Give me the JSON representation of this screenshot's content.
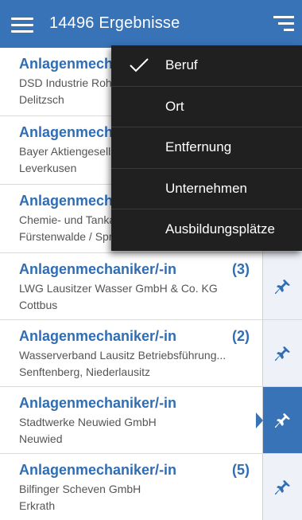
{
  "header": {
    "title": "14496 Ergebnisse",
    "menu_icon": "hamburger-menu-icon",
    "sort_icon": "sort-filter-icon",
    "color": "#3872b7"
  },
  "sort_menu": {
    "items": [
      {
        "label": "Beruf",
        "checked": true
      },
      {
        "label": "Ort",
        "checked": false
      },
      {
        "label": "Entfernung",
        "checked": false
      },
      {
        "label": "Unternehmen",
        "checked": false
      },
      {
        "label": "Ausbildungsplätze",
        "checked": false
      }
    ]
  },
  "results": [
    {
      "title": "Anlagenmechaniker/-in",
      "count": "",
      "company": "DSD Industrie Rohrleitungsbau GmbH",
      "city": "Delitzsch",
      "pinned": false
    },
    {
      "title": "Anlagenmechaniker/-in",
      "count": "",
      "company": "Bayer Aktiengesellschaft",
      "city": "Leverkusen",
      "pinned": false
    },
    {
      "title": "Anlagenmechaniker/-in",
      "count": "",
      "company": "Chemie- und Tankanlagenbau",
      "city": "Fürstenwalde / Spree",
      "pinned": false
    },
    {
      "title": "Anlagenmechaniker/-in",
      "count": "(3)",
      "company": "LWG Lausitzer Wasser GmbH & Co. KG",
      "city": "Cottbus",
      "pinned": false
    },
    {
      "title": "Anlagenmechaniker/-in",
      "count": "(2)",
      "company": "Wasserverband Lausitz Betriebsführung...",
      "city": "Senftenberg, Niederlausitz",
      "pinned": false
    },
    {
      "title": "Anlagenmechaniker/-in",
      "count": "",
      "company": "Stadtwerke Neuwied GmbH",
      "city": "Neuwied",
      "pinned": true
    },
    {
      "title": "Anlagenmechaniker/-in",
      "count": "(5)",
      "company": "Bilfinger Scheven GmbH",
      "city": "Erkrath",
      "pinned": false
    }
  ]
}
